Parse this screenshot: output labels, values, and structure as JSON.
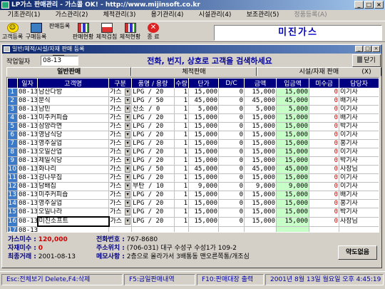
{
  "window": {
    "title": "LP가스 판매관리 - 가스콜 OK! - http://www.mijinsoft.co.kr",
    "btn_min": "_",
    "btn_max": "□",
    "btn_close": "×"
  },
  "menu": [
    {
      "label": "기초관리(1)",
      "dim": false
    },
    {
      "label": "가스관리(2)",
      "dim": false
    },
    {
      "label": "체적관리(3)",
      "dim": false
    },
    {
      "label": "용기관리(4)",
      "dim": false
    },
    {
      "label": "시설관리(4)",
      "dim": false
    },
    {
      "label": "보조관리(5)",
      "dim": false
    },
    {
      "label": "정품등록(A)",
      "dim": true
    }
  ],
  "toolbar": {
    "tools": [
      "고객등록",
      "구매등록",
      "판매등록",
      "판매현황",
      "체적검침",
      "체적현황",
      "종",
      "료"
    ],
    "brand": "미진가스"
  },
  "inner": {
    "title": "일반/체적/시설/자재 판매 등록",
    "date_label": "작업일자",
    "date_value": "08-13",
    "search_hint": "전화, 번지, 상호로 고객을 검색하세요",
    "close_label": "닫기(X)",
    "tabs": [
      "일반판매",
      "체적판매",
      "시설/자재 판매"
    ]
  },
  "grid": {
    "headers": [
      "일자",
      "고객명",
      "구분",
      "품명 / 용량",
      "수량",
      "단가",
      "D/C",
      "금액",
      "입금액",
      "미수금",
      "담당자"
    ],
    "rows": [
      {
        "no": "1",
        "date": "08-13",
        "name": "남산다방",
        "kind": "가스",
        "item": "LPG / 20",
        "qty": "1",
        "price": "15,000",
        "dc": "0",
        "amt": "15,000",
        "paid": "15,000",
        "due": "0",
        "staff": "이기사"
      },
      {
        "no": "2",
        "date": "08-13",
        "name": "분식",
        "kind": "가스",
        "item": "LPG / 50",
        "qty": "1",
        "price": "45,000",
        "dc": "0",
        "amt": "45,000",
        "paid": "45,000",
        "due": "0",
        "staff": "배기사"
      },
      {
        "no": "3",
        "date": "08-13",
        "name": "남민",
        "kind": "가스",
        "item": "산소 / 0",
        "qty": "1",
        "price": "5,000",
        "dc": "0",
        "amt": "5,000",
        "paid": "5,000",
        "due": "0",
        "staff": "이기사"
      },
      {
        "no": "4",
        "date": "08-13",
        "name": "미주커피숍",
        "kind": "가스",
        "item": "LPG / 20",
        "qty": "1",
        "price": "15,000",
        "dc": "0",
        "amt": "15,000",
        "paid": "15,000",
        "due": "0",
        "staff": "배기사"
      },
      {
        "no": "5",
        "date": "08-13",
        "name": "삼양라면",
        "kind": "가스",
        "item": "LPG / 20",
        "qty": "1",
        "price": "15,000",
        "dc": "0",
        "amt": "15,000",
        "paid": "15,000",
        "due": "0",
        "staff": "박기사"
      },
      {
        "no": "6",
        "date": "08-13",
        "name": "영남식당",
        "kind": "가스",
        "item": "LPG / 20",
        "qty": "1",
        "price": "15,000",
        "dc": "0",
        "amt": "15,000",
        "paid": "15,000",
        "due": "0",
        "staff": "이기사"
      },
      {
        "no": "7",
        "date": "08-13",
        "name": "영주실업",
        "kind": "가스",
        "item": "LPG / 20",
        "qty": "1",
        "price": "15,000",
        "dc": "0",
        "amt": "15,000",
        "paid": "15,000",
        "due": "0",
        "staff": "홍기사"
      },
      {
        "no": "8",
        "date": "08-13",
        "name": "오일산업",
        "kind": "가스",
        "item": "LPG / 20",
        "qty": "1",
        "price": "15,000",
        "dc": "0",
        "amt": "15,000",
        "paid": "15,000",
        "due": "0",
        "staff": "이기사"
      },
      {
        "no": "9",
        "date": "08-13",
        "name": "제일식당",
        "kind": "가스",
        "item": "LPG / 20",
        "qty": "1",
        "price": "15,000",
        "dc": "0",
        "amt": "15,000",
        "paid": "15,000",
        "due": "0",
        "staff": "박기사"
      },
      {
        "no": "10",
        "date": "08-13",
        "name": "화나리",
        "kind": "가스",
        "item": "LPG / 50",
        "qty": "1",
        "price": "45,000",
        "dc": "0",
        "amt": "45,000",
        "paid": "45,000",
        "due": "0",
        "staff": "사장님"
      },
      {
        "no": "11",
        "date": "08-13",
        "name": "감나무집",
        "kind": "가스",
        "item": "LPG / 20",
        "qty": "1",
        "price": "15,000",
        "dc": "0",
        "amt": "15,000",
        "paid": "15,000",
        "due": "0",
        "staff": "이기사"
      },
      {
        "no": "12",
        "date": "08-13",
        "name": "담배집",
        "kind": "가스",
        "item": "부탄 / 10",
        "qty": "1",
        "price": "9,000",
        "dc": "0",
        "amt": "9,000",
        "paid": "9,000",
        "due": "0",
        "staff": "이기사"
      },
      {
        "no": "13",
        "date": "08-13",
        "name": "미주커피숍",
        "kind": "가스",
        "item": "LPG / 20",
        "qty": "1",
        "price": "15,000",
        "dc": "0",
        "amt": "15,000",
        "paid": "15,000",
        "due": "0",
        "staff": "배기사"
      },
      {
        "no": "14",
        "date": "08-13",
        "name": "영주실업",
        "kind": "가스",
        "item": "LPG / 20",
        "qty": "1",
        "price": "15,000",
        "dc": "0",
        "amt": "15,000",
        "paid": "15,000",
        "due": "0",
        "staff": "홍기사"
      },
      {
        "no": "15",
        "date": "08-13",
        "name": "오일나라",
        "kind": "가스",
        "item": "LPG / 20",
        "qty": "1",
        "price": "15,000",
        "dc": "0",
        "amt": "15,000",
        "paid": "15,000",
        "due": "0",
        "staff": "박기사"
      },
      {
        "no": "16",
        "date": "08-13",
        "name": "미진소프트",
        "kind": "가스",
        "item": "LPG / 20",
        "qty": "1",
        "price": "15,000",
        "dc": "0",
        "amt": "15,000",
        "paid": "15,000",
        "due": "0",
        "staff": "사장님"
      },
      {
        "no": "17",
        "date": "08-13",
        "name": "",
        "kind": "",
        "item": "",
        "qty": "",
        "price": "",
        "dc": "",
        "amt": "",
        "paid": "",
        "due": "",
        "staff": ""
      }
    ]
  },
  "footer": {
    "unpaid_gas_label": "가스미수 :",
    "unpaid_gas_value": "120,000",
    "unpaid_material_label": "자재미수 :",
    "unpaid_material_value": "0",
    "last_trade_label": "최종거래 :",
    "last_trade_value": "2001-08-13",
    "phone_label": "전화번호 :",
    "phone_value": "767-8680",
    "address_label": "주소위치 :",
    "address_value": "(706-031) 대구 수성구 수성1가 109-2",
    "memo_label": "메모사항 :",
    "memo_value": "2층으로 올라가서 3배통동 맨오른쪽통/개조심",
    "result_button": "약도없음"
  },
  "status": {
    "hint1": "Esc:전체보기  Delete,F4:삭제",
    "hint2": "F5:금일판매내역",
    "hint3": "F10:판매대장 출력",
    "datetime": "2001년 8월 13일 월요일 오후 4:45:19"
  }
}
